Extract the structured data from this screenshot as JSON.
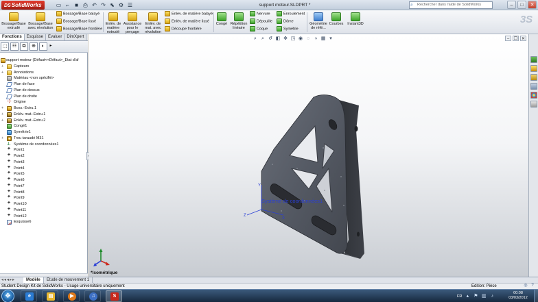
{
  "app": {
    "logo_text": "SolidWorks",
    "logo_prefix": "DS",
    "document_title": "support moteur.SLDPRT *",
    "help_search_placeholder": "Rechercher dans l'aide de SolidWorks"
  },
  "quick_access": [
    "new-icon",
    "open-icon",
    "save-icon",
    "print-icon",
    "undo-icon",
    "redo-icon",
    "select-icon",
    "rebuild-icon",
    "options-icon"
  ],
  "ribbon": {
    "large_buttons": [
      {
        "id": "boss-extrude",
        "label": "Bossage/Base extrudé"
      },
      {
        "id": "revolved-boss",
        "label": "Bossage/Base avec révolution"
      },
      {
        "id": "extruded-cut",
        "label": "Enlèv. de matière extrudé"
      },
      {
        "id": "hole-wizard",
        "label": "Assistance pour le perçage"
      },
      {
        "id": "revolved-cut",
        "label": "Enlèv. de mat. avec révolution"
      },
      {
        "id": "fillet",
        "label": "Congé"
      },
      {
        "id": "linear-pattern",
        "label": "Répétition linéaire"
      },
      {
        "id": "ref-geometry",
        "label": "Géométrie de réfé..."
      },
      {
        "id": "curves",
        "label": "Courbes"
      },
      {
        "id": "instant3d",
        "label": "Instant3D"
      }
    ],
    "small_buttons_col1": [
      "Bossage/Base balayé",
      "Bossage/Base lissé",
      "Bossage/Base frontière"
    ],
    "small_buttons_col2": [
      "Enlèv. de matière balayé",
      "Enlèv. de matière lissé",
      "Découpe frontière"
    ],
    "small_buttons_col3": [
      "Nervure",
      "Dépouille",
      "Coque"
    ],
    "small_buttons_col4": [
      "Enroulement",
      "Dôme",
      "Symétrie"
    ]
  },
  "left_tabs": [
    "Fonctions",
    "Esquisse",
    "Evaluer",
    "DimXpert"
  ],
  "feature_tree": {
    "root": "support moteur  (Défaut<<Défaut>_Etat d'af",
    "items": [
      {
        "label": "Capteurs",
        "icon": "folder-icon",
        "expand": "+"
      },
      {
        "label": "Annotations",
        "icon": "folder-icon",
        "expand": "+"
      },
      {
        "label": "Matériau <non spécifié>",
        "icon": "material-icon",
        "expand": ""
      },
      {
        "label": "Plan de face",
        "icon": "plane-icon",
        "expand": ""
      },
      {
        "label": "Plan de dessus",
        "icon": "plane-icon",
        "expand": ""
      },
      {
        "label": "Plan de droite",
        "icon": "plane-icon",
        "expand": ""
      },
      {
        "label": "Origine",
        "icon": "origin-icon",
        "expand": ""
      },
      {
        "label": "Boss.-Extru.1",
        "icon": "feature-icon",
        "expand": "+"
      },
      {
        "label": "Enlèv. mat.-Extru.1",
        "icon": "cut-icon",
        "expand": "+"
      },
      {
        "label": "Enlèv. mat.-Extru.2",
        "icon": "cut-icon",
        "expand": "+"
      },
      {
        "label": "Congé1",
        "icon": "fillet-icon",
        "expand": ""
      },
      {
        "label": "Symétrie1",
        "icon": "mirror-icon",
        "expand": ""
      },
      {
        "label": "Trou taraudé M31",
        "icon": "hole-icon",
        "expand": "+"
      },
      {
        "label": "Système de coordonnées1",
        "icon": "coordinate-icon",
        "expand": ""
      },
      {
        "label": "Point1",
        "icon": "point-icon",
        "expand": ""
      },
      {
        "label": "Point2",
        "icon": "point-icon",
        "expand": ""
      },
      {
        "label": "Point3",
        "icon": "point-icon",
        "expand": ""
      },
      {
        "label": "Point4",
        "icon": "point-icon",
        "expand": ""
      },
      {
        "label": "Point5",
        "icon": "point-icon",
        "expand": ""
      },
      {
        "label": "Point6",
        "icon": "point-icon",
        "expand": ""
      },
      {
        "label": "Point7",
        "icon": "point-icon",
        "expand": ""
      },
      {
        "label": "Point8",
        "icon": "point-icon",
        "expand": ""
      },
      {
        "label": "Point9",
        "icon": "point-icon",
        "expand": ""
      },
      {
        "label": "Point10",
        "icon": "point-icon",
        "expand": ""
      },
      {
        "label": "Point11",
        "icon": "point-icon",
        "expand": ""
      },
      {
        "label": "Point12",
        "icon": "point-icon",
        "expand": ""
      },
      {
        "label": "Esquisse6",
        "icon": "sketch-icon",
        "expand": ""
      }
    ]
  },
  "viewport": {
    "coordinate_system_label": "Système de coordonnées1",
    "view_orientation": "*Isométrique",
    "triad_labels": [
      "Y",
      "X",
      "Z"
    ],
    "part_color": "#555a64"
  },
  "bottom_tabs": [
    "Modèle",
    "Etude de mouvement 1"
  ],
  "status": {
    "left": "Student Design Kit de SolidWorks - Usage universitaire uniquement",
    "right": "Edition: Pièce"
  },
  "taskbar": {
    "language": "FR",
    "time": "00:08",
    "date": "03/03/2012"
  }
}
